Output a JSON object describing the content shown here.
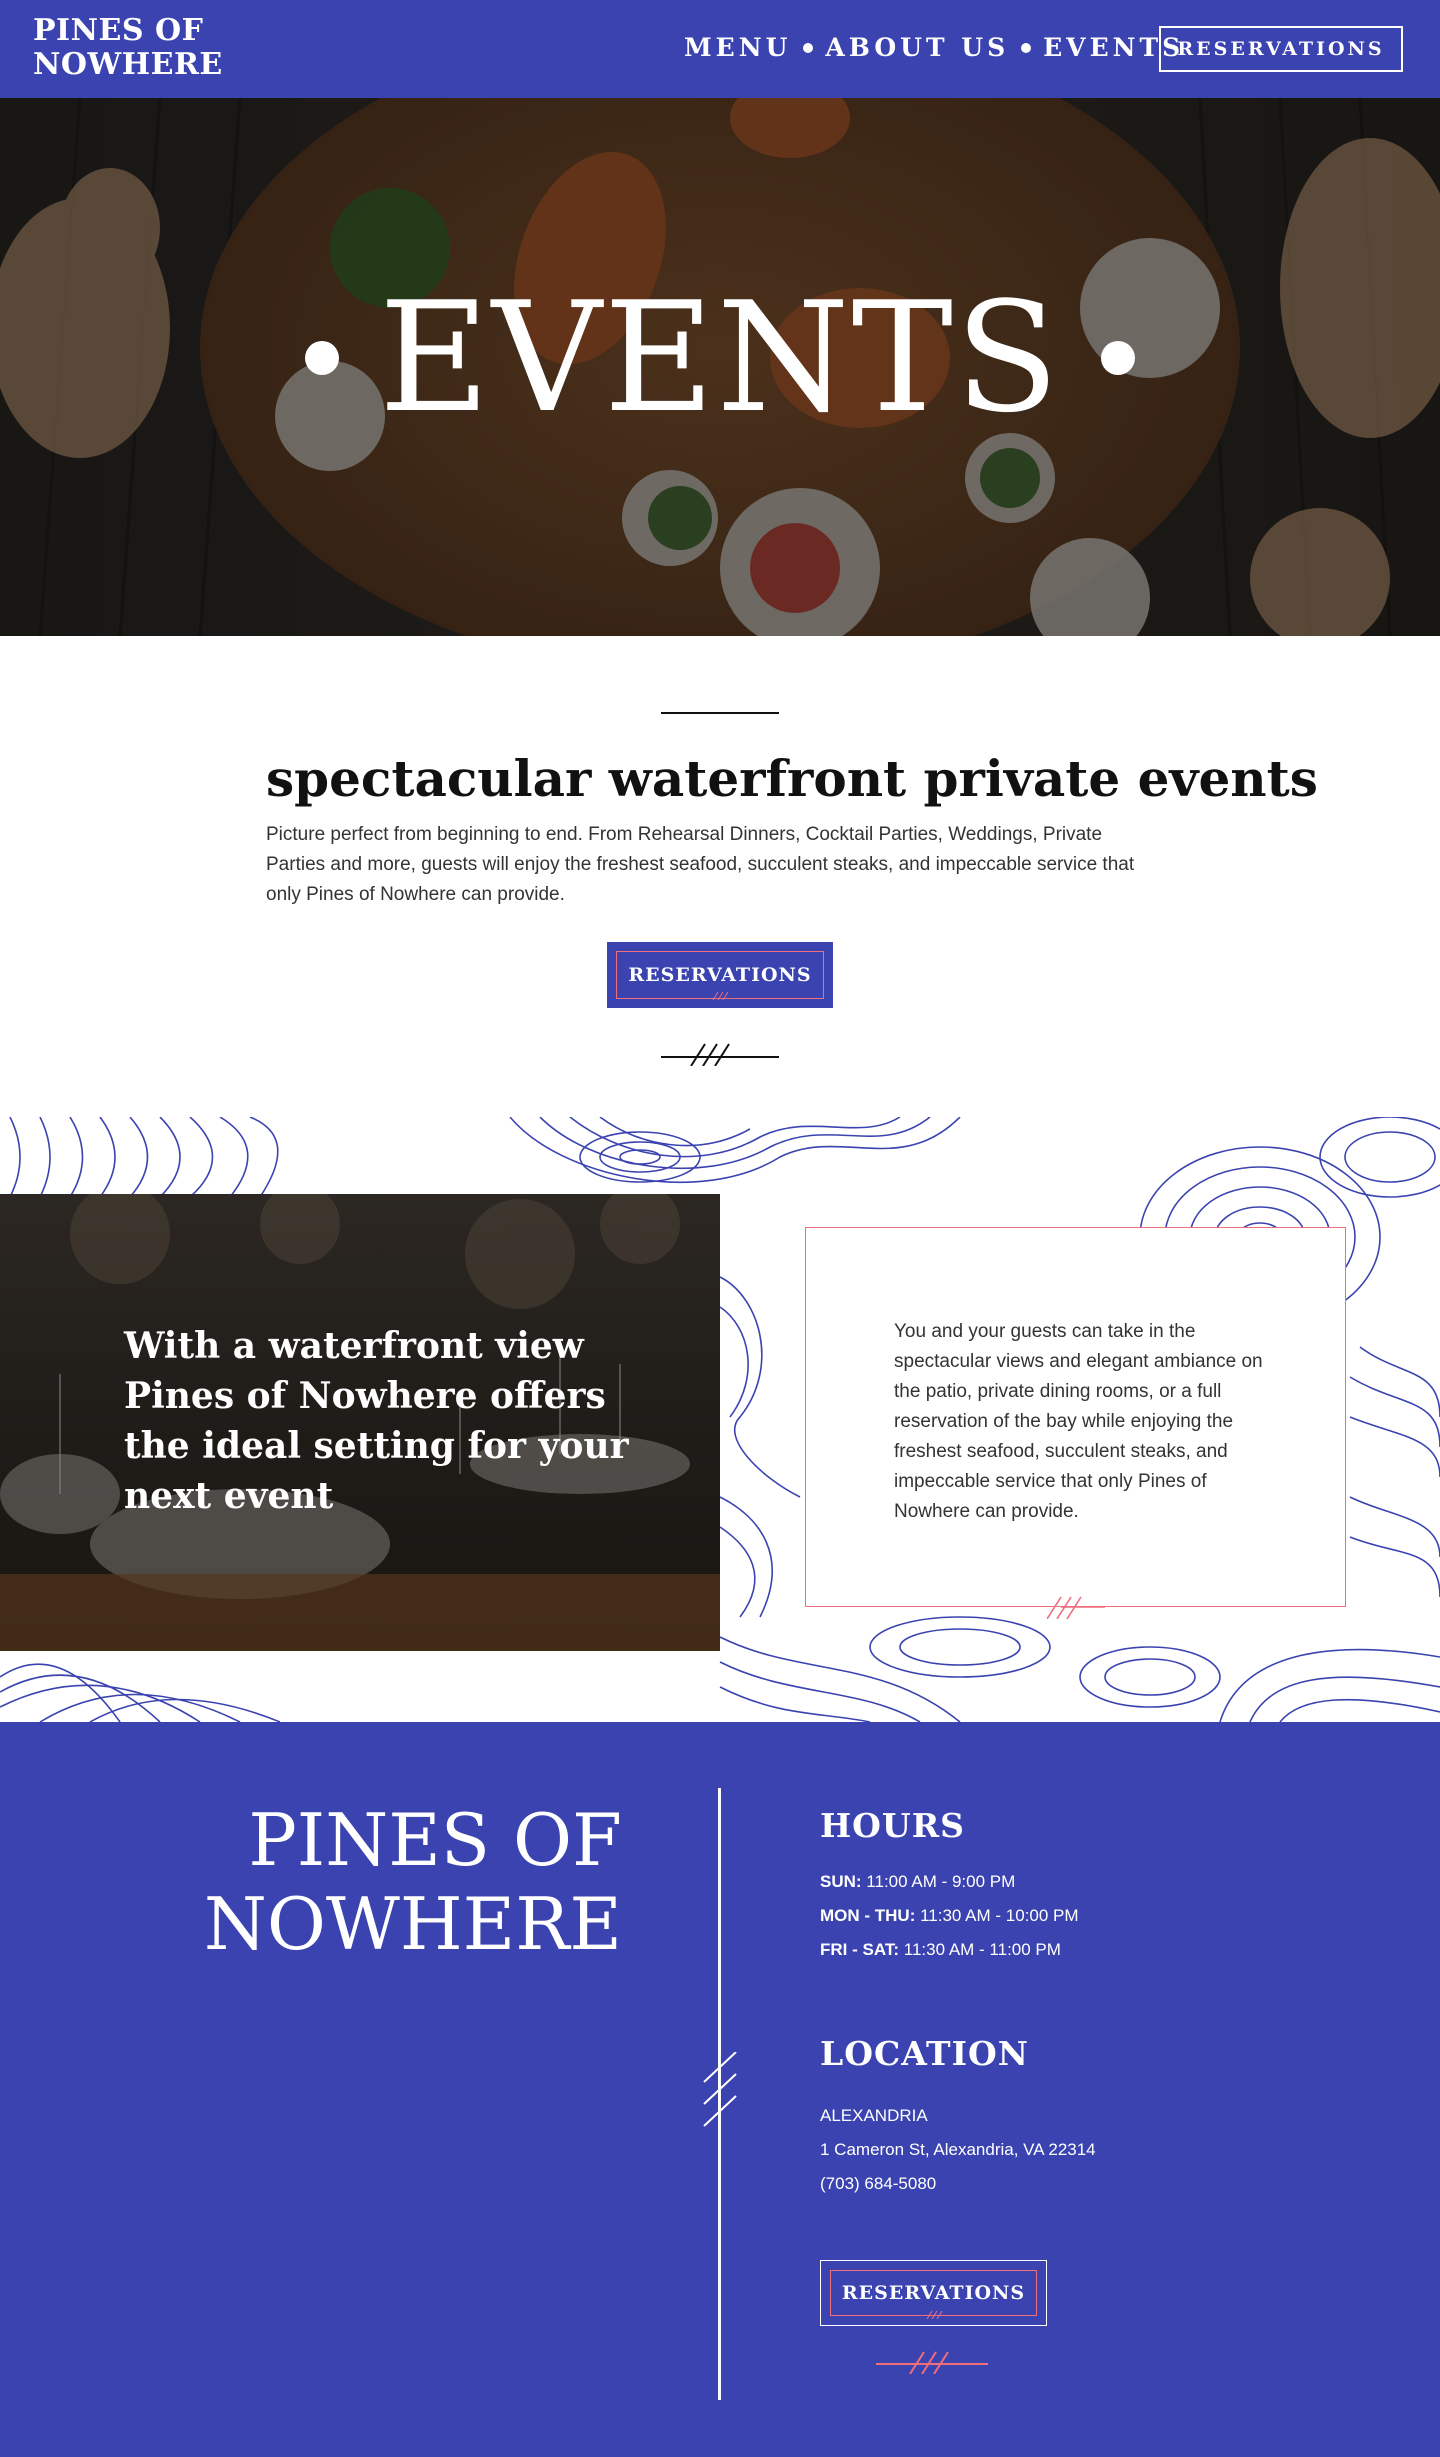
{
  "header": {
    "logo_line1": "PINES OF",
    "logo_line2": "NOWHERE",
    "nav": [
      "MENU",
      "ABOUT US",
      "EVENTS"
    ],
    "reservations_label": "RESERVATIONS"
  },
  "hero": {
    "title": "EVENTS"
  },
  "intro": {
    "title": "spectacular waterfront private events",
    "text": "Picture perfect from beginning to end. From Rehearsal Dinners, Cocktail Parties, Weddings, Private Parties and more, guests will enjoy the freshest seafood, succulent steaks, and impeccable service that only Pines of Nowhere can provide.",
    "button_label": "RESERVATIONS"
  },
  "feature": {
    "headline": "With a waterfront view Pines of Nowhere offers the ideal setting for your next event",
    "card_text": "You and your guests can take in the spectacular views and elegant ambiance on the patio, private dining rooms, or a full reservation of the bay while enjoying the freshest seafood, succulent steaks, and impeccable service that only Pines of Nowhere can provide."
  },
  "footer": {
    "name_line1": "PINES OF",
    "name_line2": "NOWHERE",
    "hours_heading": "HOURS",
    "hours": [
      {
        "days": "SUN:",
        "time": "11:00 AM - 9:00 PM"
      },
      {
        "days": "MON - THU:",
        "time": "11:30 AM - 10:00 PM"
      },
      {
        "days": "FRI - SAT:",
        "time": "11:30 AM - 11:00 PM"
      }
    ],
    "location_heading": "LOCATION",
    "city": "ALEXANDRIA",
    "address": "1 Cameron St, Alexandria, VA 22314",
    "phone": "(703) 684-5080",
    "button_label": "RESERVATIONS"
  },
  "colors": {
    "brand_blue": "#3b43b0",
    "accent_coral": "#ee6e7c"
  }
}
